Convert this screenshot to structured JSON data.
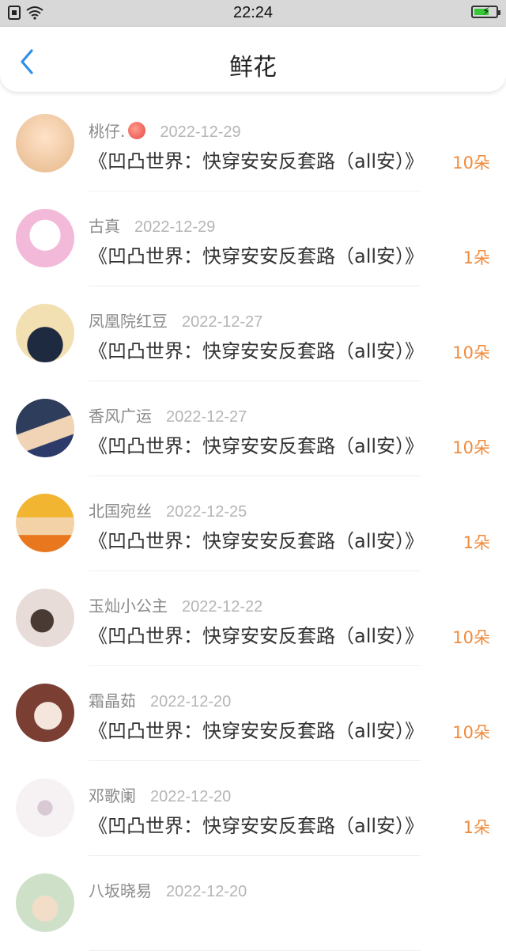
{
  "status": {
    "time": "22:24"
  },
  "header": {
    "title": "鲜花"
  },
  "items": [
    {
      "name": "桃仔.",
      "date": "2022-12-29",
      "book": "《凹凸世界：快穿安安反套路（all安）》",
      "count": "10朵",
      "avatar_color": "#f3d7b8",
      "has_peach": true
    },
    {
      "name": "古真",
      "date": "2022-12-29",
      "book": "《凹凸世界：快穿安安反套路（all安）》",
      "count": "1朵",
      "avatar_color": "#f7c6e0"
    },
    {
      "name": "凤凰院红豆",
      "date": "2022-12-27",
      "book": "《凹凸世界：快穿安安反套路（all安）》",
      "count": "10朵",
      "avatar_color": "#f0dca8"
    },
    {
      "name": "香风广运",
      "date": "2022-12-27",
      "book": "《凹凸世界：快穿安安反套路（all安）》",
      "count": "10朵",
      "avatar_color": "#3a4a6a"
    },
    {
      "name": "北国宛丝",
      "date": "2022-12-25",
      "book": "《凹凸世界：快穿安安反套路（all安）》",
      "count": "1朵",
      "avatar_color": "#e89a2a"
    },
    {
      "name": "玉灿小公主",
      "date": "2022-12-22",
      "book": "《凹凸世界：快穿安安反套路（all安）》",
      "count": "10朵",
      "avatar_color": "#d8d2cc"
    },
    {
      "name": "霜晶茹",
      "date": "2022-12-20",
      "book": "《凹凸世界：快穿安安反套路（all安）》",
      "count": "10朵",
      "avatar_color": "#6b3b2e"
    },
    {
      "name": "邓歌阑",
      "date": "2022-12-20",
      "book": "《凹凸世界：快穿安安反套路（all安）》",
      "count": "1朵",
      "avatar_color": "#f2eef0"
    },
    {
      "name": "八坂晓易",
      "date": "2022-12-20",
      "book": "",
      "count": "",
      "avatar_color": "#cfe0c8"
    }
  ]
}
